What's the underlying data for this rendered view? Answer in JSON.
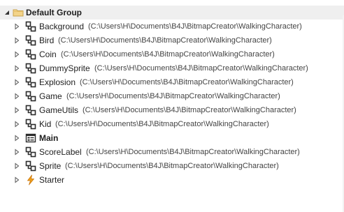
{
  "group": {
    "label": "Default Group"
  },
  "modules": [
    {
      "name": "Background",
      "path": "(C:\\Users\\H\\Documents\\B4J\\BitmapCreator\\WalkingCharacter)",
      "icon": "class-module-icon",
      "bold": false
    },
    {
      "name": "Bird",
      "path": "(C:\\Users\\H\\Documents\\B4J\\BitmapCreator\\WalkingCharacter)",
      "icon": "class-module-icon",
      "bold": false
    },
    {
      "name": "Coin",
      "path": "(C:\\Users\\H\\Documents\\B4J\\BitmapCreator\\WalkingCharacter)",
      "icon": "class-module-icon",
      "bold": false
    },
    {
      "name": "DummySprite",
      "path": "(C:\\Users\\H\\Documents\\B4J\\BitmapCreator\\WalkingCharacter)",
      "icon": "class-module-icon",
      "bold": false
    },
    {
      "name": "Explosion",
      "path": "(C:\\Users\\H\\Documents\\B4J\\BitmapCreator\\WalkingCharacter)",
      "icon": "class-module-icon",
      "bold": false
    },
    {
      "name": "Game",
      "path": "(C:\\Users\\H\\Documents\\B4J\\BitmapCreator\\WalkingCharacter)",
      "icon": "class-module-icon",
      "bold": false
    },
    {
      "name": "GameUtils",
      "path": "(C:\\Users\\H\\Documents\\B4J\\BitmapCreator\\WalkingCharacter)",
      "icon": "class-module-icon",
      "bold": false
    },
    {
      "name": "Kid",
      "path": "(C:\\Users\\H\\Documents\\B4J\\BitmapCreator\\WalkingCharacter)",
      "icon": "class-module-icon",
      "bold": false
    },
    {
      "name": "Main",
      "path": "",
      "icon": "main-module-icon",
      "bold": true
    },
    {
      "name": "ScoreLabel",
      "path": "(C:\\Users\\H\\Documents\\B4J\\BitmapCreator\\WalkingCharacter)",
      "icon": "class-module-icon",
      "bold": false
    },
    {
      "name": "Sprite",
      "path": "(C:\\Users\\H\\Documents\\B4J\\BitmapCreator\\WalkingCharacter)",
      "icon": "class-module-icon",
      "bold": false
    },
    {
      "name": "Starter",
      "path": "",
      "icon": "lightning-icon",
      "bold": false
    }
  ]
}
